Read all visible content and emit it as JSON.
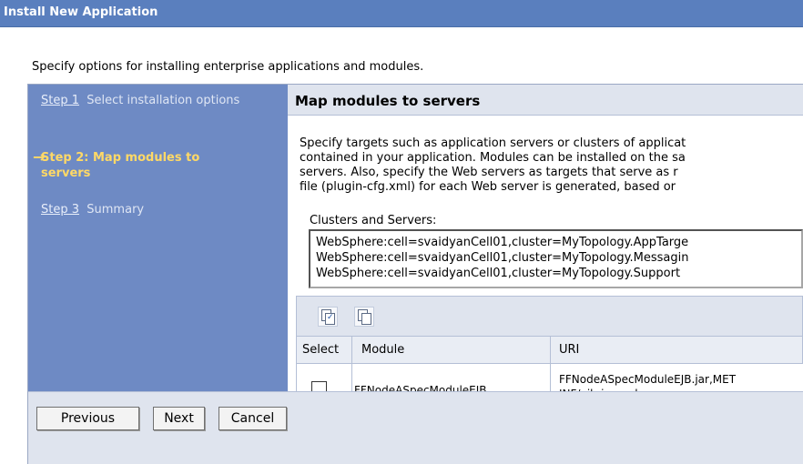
{
  "window": {
    "title": "Install New Application"
  },
  "intro_text": "Specify options for installing enterprise applications and modules.",
  "steps": [
    {
      "link": "Step 1",
      "text": "Select installation options"
    },
    {
      "text": "Step 2: Map modules to servers",
      "current": true
    },
    {
      "link": "Step 3",
      "text": "Summary"
    }
  ],
  "panel": {
    "title": "Map modules to servers",
    "description_lines": [
      "Specify targets such as application servers or clusters of applicat",
      "contained in your application. Modules can be installed on the sa",
      "servers. Also, specify the Web servers as targets that serve as r",
      "file (plugin-cfg.xml) for each Web server is generated, based or"
    ],
    "clusters_label": "Clusters and Servers:",
    "clusters": [
      "WebSphere:cell=svaidyanCell01,cluster=MyTopology.AppTarge",
      "WebSphere:cell=svaidyanCell01,cluster=MyTopology.Messagin",
      "WebSphere:cell=svaidyanCell01,cluster=MyTopology.Support"
    ]
  },
  "table": {
    "toolbar_icons": [
      "select-all-icon",
      "deselect-all-icon"
    ],
    "columns": [
      "Select",
      "Module",
      "URI"
    ],
    "rows": [
      {
        "selected": false,
        "module": "FFNodeASpecModuleEJB",
        "uri_line1": "FFNodeASpecModuleEJB.jar,MET",
        "uri_line2": "INF/ejb-jar.xml"
      }
    ]
  },
  "buttons": {
    "previous": "Previous",
    "next": "Next",
    "cancel": "Cancel"
  },
  "colors": {
    "title_bar": "#5a7fbe",
    "steps_bg": "#6e8ac4",
    "current_step": "#ffd966",
    "panel_bg": "#dfe4ee"
  }
}
